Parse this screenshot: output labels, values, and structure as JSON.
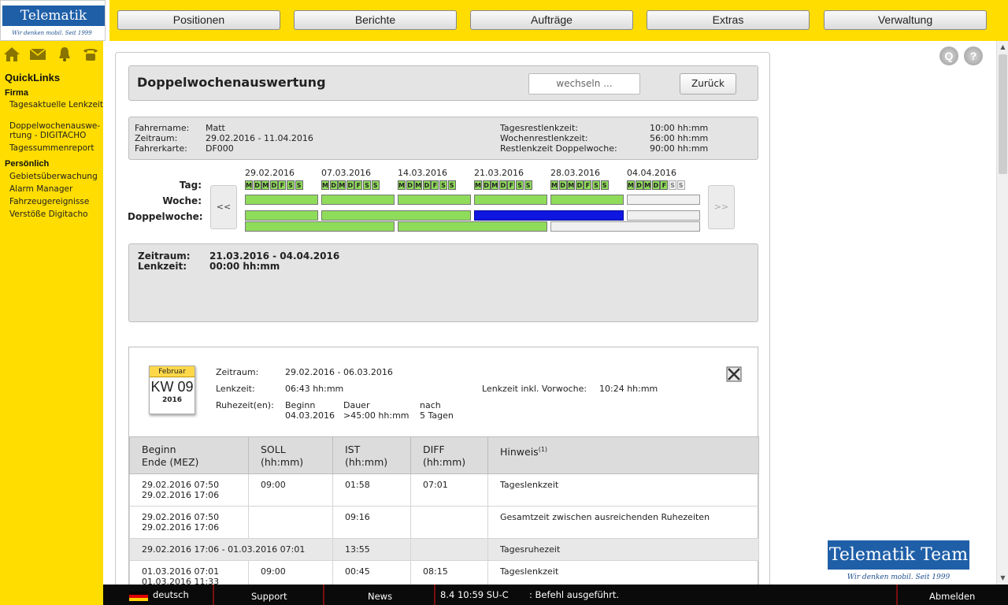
{
  "logo": {
    "title": "Telematik Team",
    "subtitle": "Wir denken mobil. Seit 1999"
  },
  "topnav": [
    "Positionen",
    "Berichte",
    "Aufträge",
    "Extras",
    "Verwaltung"
  ],
  "sidebar": {
    "icons": [
      "home-icon",
      "mail-icon",
      "bell-icon",
      "phone-icon"
    ],
    "quicklinks_title": "QuickLinks",
    "sections": [
      {
        "title": "Firma",
        "items": [
          "Tagesaktuelle Lenkzeit",
          "Doppelwochenauswe-rtung - DIGITACHO",
          "Tagessummenreport"
        ]
      },
      {
        "title": "Persönlich",
        "items": [
          "Gebietsüberwachung",
          "Alarm Manager",
          "Fahrzeugereignisse",
          "Verstöße Digitacho"
        ]
      }
    ]
  },
  "page": {
    "title": "Doppelwochenauswertung",
    "switch_label": "wechseln ...",
    "back_label": "Zurück"
  },
  "info": {
    "driver_name_label": "Fahrername:",
    "driver_name": "Matt",
    "period_label": "Zeitraum:",
    "period": "29.02.2016 - 11.04.2016",
    "card_label": "Fahrerkarte:",
    "card": "DF000",
    "day_rest_label": "Tagesrestlenkzeit:",
    "day_rest": "10:00 hh:mm",
    "week_rest_label": "Wochenrestlenkzeit:",
    "week_rest": "56:00 hh:mm",
    "dw_rest_label": "Restlenkzeit Doppelwoche:",
    "dw_rest": "90:00 hh:mm"
  },
  "timeline": {
    "row_labels": {
      "day": "Tag:",
      "week": "Woche:",
      "double": "Doppelwoche:"
    },
    "prev": "<<",
    "next": ">>",
    "weeks": [
      {
        "date": "29.02.2016",
        "state": "green"
      },
      {
        "date": "07.03.2016",
        "state": "green"
      },
      {
        "date": "14.03.2016",
        "state": "green"
      },
      {
        "date": "21.03.2016",
        "state": "green"
      },
      {
        "date": "28.03.2016",
        "state": "green"
      },
      {
        "date": "04.04.2016",
        "state": "partial"
      }
    ],
    "day_letters": [
      "M",
      "D",
      "M",
      "D",
      "F",
      "S",
      "S"
    ]
  },
  "summary": {
    "period_label": "Zeitraum:",
    "period": "21.03.2016 - 04.04.2016",
    "driving_label": "Lenkzeit:",
    "driving": "00:00 hh:mm"
  },
  "detail": {
    "calendar": {
      "month": "Februar",
      "kw": "KW 09",
      "year": "2016"
    },
    "period_label": "Zeitraum:",
    "period": "29.02.2016 - 06.03.2016",
    "driving_label": "Lenkzeit:",
    "driving": "06:43 hh:mm",
    "driving_prev_label": "Lenkzeit inkl. Vorwoche:",
    "driving_prev": "10:24 hh:mm",
    "rest_label": "Ruhezeit(en):",
    "rest_begin_label": "Beginn",
    "rest_begin": "04.03.2016",
    "rest_duration_label": "Dauer",
    "rest_duration": ">45:00 hh:mm",
    "rest_after_label": "nach",
    "rest_after": "5 Tagen"
  },
  "table": {
    "headers": {
      "begin": "Beginn",
      "end": "Ende (MEZ)",
      "soll": "SOLL",
      "soll_unit": "(hh:mm)",
      "ist": "IST",
      "ist_unit": "(hh:mm)",
      "diff": "DIFF",
      "diff_unit": "(hh:mm)",
      "hint": "Hinweis",
      "hint_sup": "(1)"
    },
    "rows": [
      {
        "begin": "29.02.2016 07:50",
        "end": "29.02.2016 17:06",
        "soll": "09:00",
        "ist": "01:58",
        "diff": "07:01",
        "hint": "Tageslenkzeit"
      },
      {
        "begin": "29.02.2016 07:50",
        "end": "29.02.2016 17:06",
        "soll": "",
        "ist": "09:16",
        "diff": "",
        "hint": "Gesamtzeit zwischen ausreichenden Ruhezeiten"
      },
      {
        "span": "29.02.2016 17:06 - 01.03.2016 07:01",
        "ist": "13:55",
        "hint": "Tagesruhezeit"
      },
      {
        "begin": "01.03.2016 07:01",
        "end": "01.03.2016 11:33",
        "soll": "09:00",
        "ist": "00:45",
        "diff": "08:15",
        "hint": "Tageslenkzeit"
      }
    ]
  },
  "bottombar": {
    "language": "deutsch",
    "support": "Support",
    "news": "News",
    "status": "8.4 10:59  SU-C",
    "status_msg": ": Befehl ausgeführt.",
    "logout": "Abmelden"
  },
  "colors": {
    "accent": "#ffdd00",
    "green": "#8fdc5a",
    "blue": "#0f16e0",
    "brand": "#1f5fa8"
  }
}
